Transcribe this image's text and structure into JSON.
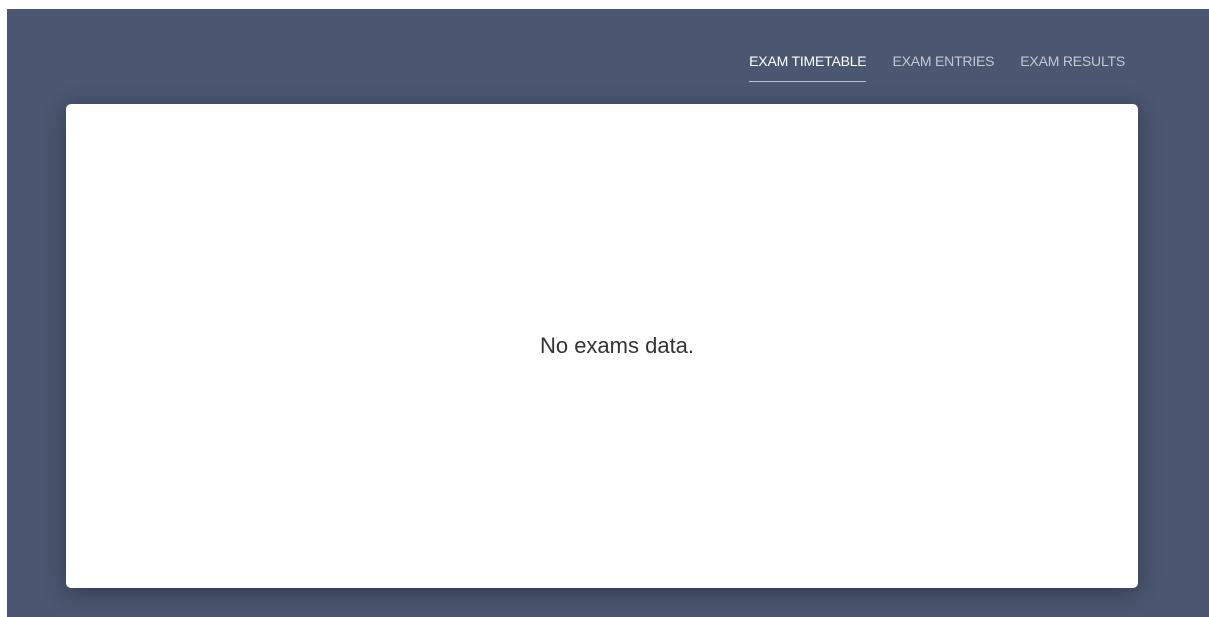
{
  "tabs": [
    {
      "label": "EXAM TIMETABLE",
      "active": true
    },
    {
      "label": "EXAM ENTRIES",
      "active": false
    },
    {
      "label": "EXAM RESULTS",
      "active": false
    }
  ],
  "main": {
    "empty_message": "No exams data."
  },
  "colors": {
    "background": "#4b5670",
    "card": "#ffffff",
    "tab_active": "#ffffff",
    "tab_inactive": "#c3c8d3",
    "tab_underline": "#b9c4d8"
  }
}
